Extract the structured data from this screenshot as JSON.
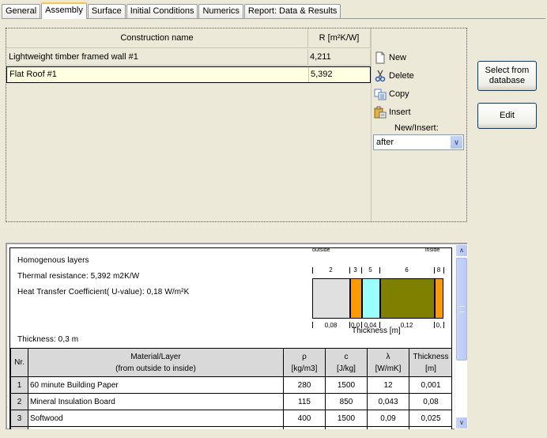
{
  "tabs": [
    {
      "label": "General",
      "active": false
    },
    {
      "label": "Assembly",
      "active": true
    },
    {
      "label": "Surface",
      "active": false
    },
    {
      "label": "Initial Conditions",
      "active": false
    },
    {
      "label": "Numerics",
      "active": false
    },
    {
      "label": "Report: Data & Results",
      "active": false
    }
  ],
  "constructions": {
    "columns": {
      "name": "Construction name",
      "r": "R [m²K/W]"
    },
    "rows": [
      {
        "name": "Lightweight timber framed wall #1",
        "r": "4,211",
        "selected": false
      },
      {
        "name": "Flat Roof #1",
        "r": "5,392",
        "selected": true
      }
    ]
  },
  "actions": {
    "new": "New",
    "delete": "Delete",
    "copy": "Copy",
    "insert": "Insert",
    "new_insert_label": "New/Insert:",
    "new_insert_value": "after"
  },
  "buttons": {
    "select_from_database_line1": "Select from",
    "select_from_database_line2": "database",
    "edit": "Edit"
  },
  "report": {
    "type_text": "Homogenous layers",
    "thermal_resistance": "Thermal resistance: 5,392  m2K/W",
    "u_value": "Heat Transfer Coefficient( U-value): 0,18 W/m²K",
    "thickness": "Thickness: 0,3   m",
    "diagram": {
      "outside_label": "outside",
      "inside_label": "inside",
      "axis_title": "Thickness [m]",
      "layers": [
        {
          "nr": "2",
          "thickness_label": "0,08",
          "color": "#e0e0e0"
        },
        {
          "nr": "3",
          "thickness_label": "0,0",
          "color": "#ff9900"
        },
        {
          "nr": "5",
          "thickness_label": "0,04",
          "color": "#99ffff"
        },
        {
          "nr": "6",
          "thickness_label": "0,12",
          "color": "#808000"
        },
        {
          "nr": "8",
          "thickness_label": "0,",
          "color": "#ff9900"
        }
      ]
    },
    "table": {
      "headers": {
        "nr": "Nr.",
        "material_line1": "Material/Layer",
        "material_line2": "(from outside to inside)",
        "rho_line1": "ρ",
        "rho_line2": "[kg/m3]",
        "c_line1": "c",
        "c_line2": "[J/kg]",
        "lambda_line1": "λ",
        "lambda_line2": "[W/mK]",
        "thickness_line1": "Thickness",
        "thickness_line2": "[m]"
      },
      "rows": [
        {
          "nr": "1",
          "material": "60 minute Building Paper",
          "rho": "280",
          "c": "1500",
          "lambda": "12",
          "thickness": "0,001"
        },
        {
          "nr": "2",
          "material": "Mineral Insulation Board",
          "rho": "115",
          "c": "850",
          "lambda": "0,043",
          "thickness": "0,08"
        },
        {
          "nr": "3",
          "material": "Softwood",
          "rho": "400",
          "c": "1500",
          "lambda": "0,09",
          "thickness": "0,025"
        }
      ]
    }
  }
}
